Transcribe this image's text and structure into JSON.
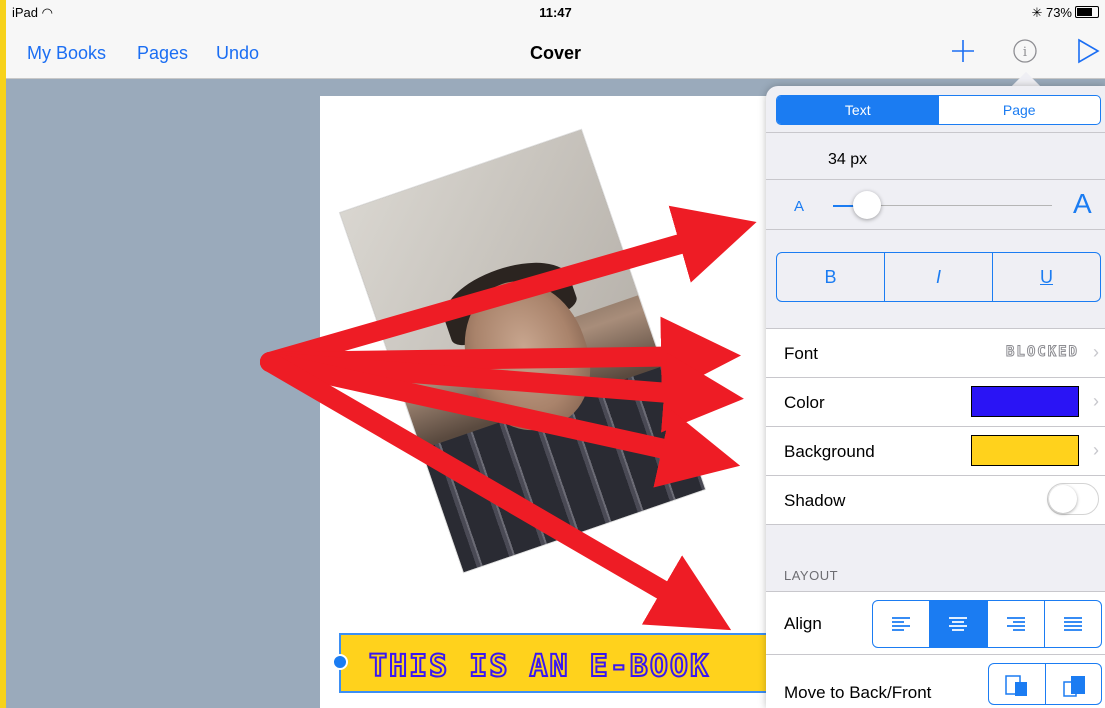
{
  "status": {
    "device": "iPad",
    "time": "11:47",
    "battery": "73%"
  },
  "nav": {
    "my_books": "My Books",
    "pages": "Pages",
    "undo": "Undo",
    "title": "Cover"
  },
  "page": {
    "title_text": "THIS IS AN E-BOOK"
  },
  "panel": {
    "tabs": [
      {
        "label": "Text",
        "active": true
      },
      {
        "label": "Page",
        "active": false
      }
    ],
    "font_size": "34 px",
    "size_small": "A",
    "size_large": "A",
    "slider_value": 0.12,
    "bold": "B",
    "italic": "I",
    "underline": "U",
    "rows": {
      "font": {
        "label": "Font",
        "value": "BLOCKED"
      },
      "color": {
        "label": "Color",
        "swatch": "#2a14f5"
      },
      "background": {
        "label": "Background",
        "swatch": "#ffd21c"
      },
      "shadow": {
        "label": "Shadow",
        "on": false
      }
    },
    "layout_header": "LAYOUT",
    "align": {
      "label": "Align",
      "selected": "center",
      "options": [
        "left",
        "center",
        "right",
        "justify"
      ]
    },
    "move": {
      "label": "Move to Back/Front"
    }
  },
  "colors": {
    "accent": "#1b7cf2",
    "arrow": "#ee1c25",
    "frame": "#f7d21a"
  }
}
